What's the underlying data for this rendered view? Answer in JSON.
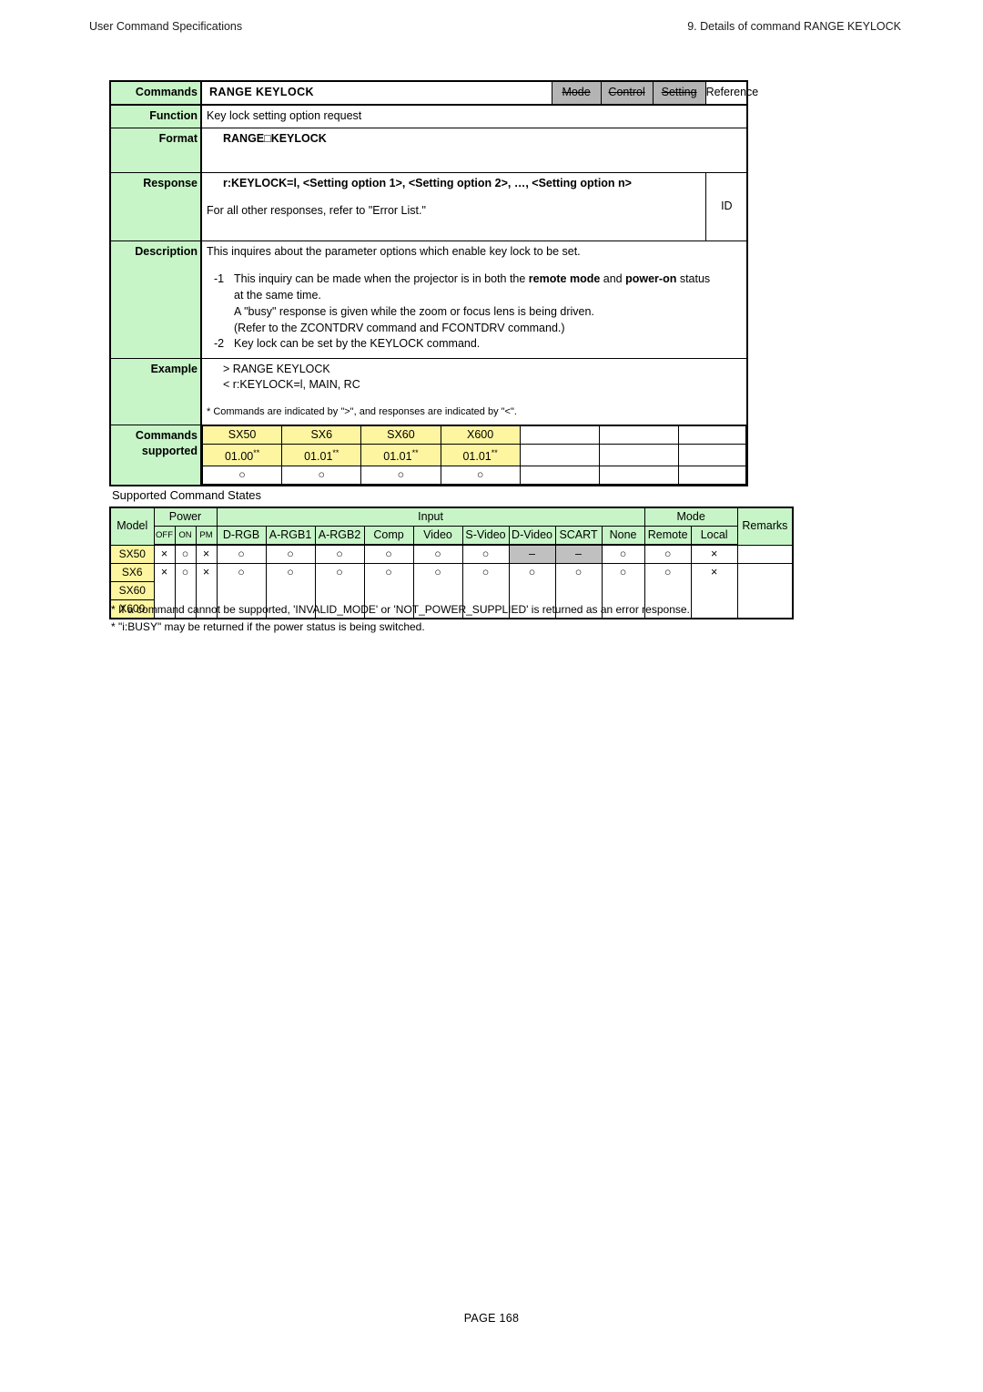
{
  "page_header": {
    "left": "User Command Specifications",
    "right": "9. Details of command  RANGE KEYLOCK"
  },
  "command": {
    "label_commands": "Commands",
    "name": "RANGE KEYLOCK",
    "tags": [
      {
        "label": "Mode",
        "active": false
      },
      {
        "label": "Control",
        "active": false
      },
      {
        "label": "Setting",
        "active": false
      },
      {
        "label": "Reference",
        "active": true
      }
    ],
    "rows": {
      "function": {
        "label": "Function",
        "text": "Key lock setting option request"
      },
      "format": {
        "label": "Format",
        "text": "RANGE□KEYLOCK"
      },
      "response": {
        "label": "Response",
        "line1": "r:KEYLOCK=l, <Setting option 1>, <Setting option 2>, …, <Setting option n>",
        "line2": "For all other responses, refer to \"Error List.\"",
        "id_cell": "ID"
      },
      "description": {
        "label": "Description",
        "intro": "This inquires about the parameter options which enable key lock to be set.",
        "items": [
          {
            "num": "-1",
            "parts_pre": "This inquiry can be made when the projector is in both the ",
            "bold1": "remote mode",
            "parts_mid": " and ",
            "bold2": "power-on",
            "parts_post": " status",
            "sub_lines": [
              "at the same time.",
              "A \"busy\" response is given while the zoom or focus lens is being driven.",
              "(Refer to the ZCONTDRV command and FCONTDRV command.)"
            ]
          },
          {
            "num": "-2",
            "plain": "Key lock can be set by the KEYLOCK command.",
            "sub_lines": []
          }
        ]
      },
      "example": {
        "label": "Example",
        "lines": [
          "> RANGE KEYLOCK",
          "< r:KEYLOCK=l, MAIN, RC"
        ],
        "note": "* Commands are indicated by \">\", and responses are indicated by \"<\"."
      },
      "commands_supported": {
        "label_line1": "Commands",
        "label_line2": "supported",
        "models": [
          {
            "name": "SX50",
            "version": "01.00",
            "version_sup": "**",
            "mark": "○"
          },
          {
            "name": "SX6",
            "version": "01.01",
            "version_sup": "**",
            "mark": "○"
          },
          {
            "name": "SX60",
            "version": "01.01",
            "version_sup": "**",
            "mark": "○"
          },
          {
            "name": "X600",
            "version": "01.01",
            "version_sup": "**",
            "mark": "○"
          },
          {
            "name": "",
            "version": "",
            "version_sup": "",
            "mark": ""
          },
          {
            "name": "",
            "version": "",
            "version_sup": "",
            "mark": ""
          },
          {
            "name": "",
            "version": "",
            "version_sup": "",
            "mark": ""
          }
        ]
      }
    }
  },
  "states": {
    "caption": "Supported Command States",
    "group_headers": {
      "model": "Model",
      "power": "Power",
      "input": "Input",
      "mode": "Mode",
      "remarks": "Remarks"
    },
    "sub_headers": {
      "power": [
        "OFF",
        "ON",
        "PM"
      ],
      "input": [
        "D-RGB",
        "A-RGB1",
        "A-RGB2",
        "Comp",
        "Video",
        "S-Video",
        "D-Video",
        "SCART",
        "None"
      ],
      "mode": [
        "Remote",
        "Local"
      ]
    },
    "rows": [
      {
        "models": [
          "SX50"
        ],
        "power": [
          "×",
          "○",
          "×"
        ],
        "input": [
          "○",
          "○",
          "○",
          "○",
          "○",
          "○",
          "–",
          "–",
          "○"
        ],
        "input_gray": [
          false,
          false,
          false,
          false,
          false,
          false,
          true,
          true,
          false
        ],
        "mode": [
          "○",
          "×"
        ],
        "remarks": ""
      },
      {
        "models": [
          "SX6",
          "SX60",
          "X600"
        ],
        "power": [
          "×",
          "○",
          "×"
        ],
        "input": [
          "○",
          "○",
          "○",
          "○",
          "○",
          "○",
          "○",
          "○",
          "○"
        ],
        "input_gray": [
          false,
          false,
          false,
          false,
          false,
          false,
          false,
          false,
          false
        ],
        "mode": [
          "○",
          "×"
        ],
        "remarks": ""
      }
    ]
  },
  "footnotes": [
    "* If a command cannot be supported, 'INVALID_MODE' or 'NOT_POWER_SUPPLIED' is returned as an error response.",
    "* \"i:BUSY\" may be returned if the power status is being switched."
  ],
  "page_footer": "PAGE 168"
}
